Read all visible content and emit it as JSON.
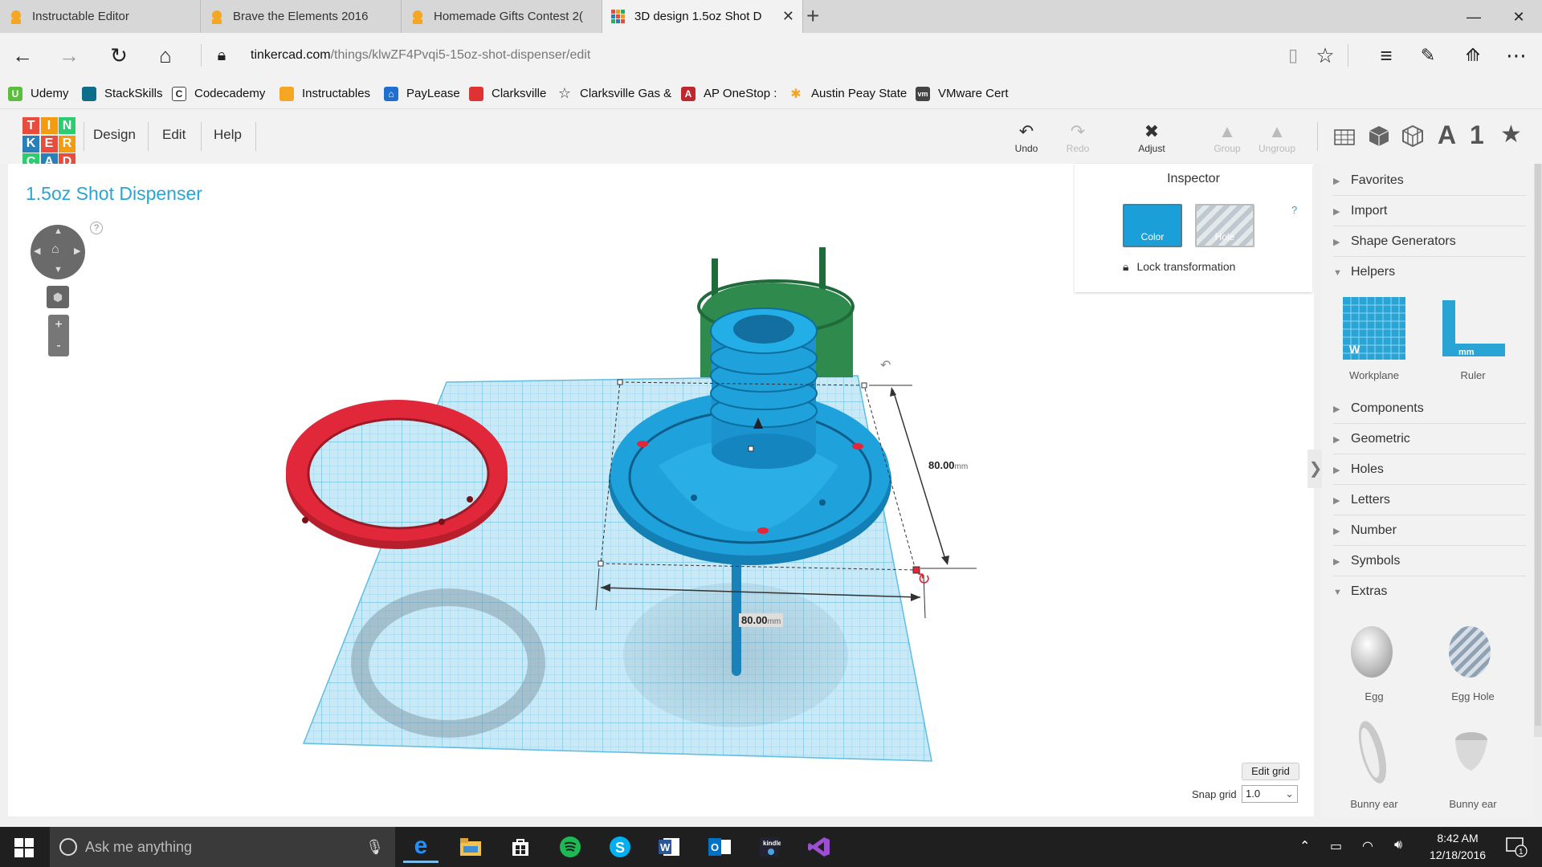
{
  "browser": {
    "tabs": [
      {
        "title": "Instructable Editor"
      },
      {
        "title": "Brave the Elements 2016"
      },
      {
        "title": "Homemade Gifts Contest 2("
      },
      {
        "title": "3D design 1.5oz Shot D",
        "active": true
      }
    ],
    "new_tab": "+",
    "window": {
      "minimize": "—",
      "maximize": "❐",
      "close": "✕"
    },
    "url_host": "tinkercad.com",
    "url_path": "/things/klwZF4Pvqi5-15oz-shot-dispenser/edit",
    "favorites": [
      {
        "label": "Udemy",
        "icon": "udemy-icon",
        "color": "#5bbf3d",
        "glyph": "U"
      },
      {
        "label": "StackSkills",
        "icon": "stackskills-icon",
        "color": "#0d6e8c",
        "glyph": ""
      },
      {
        "label": "Codecademy",
        "icon": "codecademy-icon",
        "color": "#ffffff",
        "glyph": "C"
      },
      {
        "label": "Instructables",
        "icon": "instructables-icon",
        "color": "#f5a623",
        "glyph": ""
      },
      {
        "label": "PayLease",
        "icon": "paylease-icon",
        "color": "#1e6fd1",
        "glyph": "⌂"
      },
      {
        "label": "Clarksville",
        "icon": "clarksville-icon",
        "color": "#d33",
        "glyph": ""
      },
      {
        "label": "Clarksville Gas &",
        "icon": "star-icon",
        "color": "#ffffff",
        "glyph": "☆"
      },
      {
        "label": "AP OneStop :",
        "icon": "ap-icon",
        "color": "#c0262d",
        "glyph": "A"
      },
      {
        "label": "Austin Peay State",
        "icon": "austin-peay-icon",
        "color": "#f5a623",
        "glyph": "✱"
      },
      {
        "label": "VMware Cert",
        "icon": "vmware-icon",
        "color": "#444444",
        "glyph": "vm"
      }
    ]
  },
  "app": {
    "logo_letters": [
      "T",
      "I",
      "N",
      "K",
      "E",
      "R",
      "C",
      "A",
      "D"
    ],
    "menu": [
      "Design",
      "Edit",
      "Help"
    ],
    "tools": [
      {
        "label": "Undo",
        "icon": "undo-icon",
        "enabled": true
      },
      {
        "label": "Redo",
        "icon": "redo-icon",
        "enabled": false
      },
      {
        "label": "Adjust",
        "icon": "adjust-icon",
        "enabled": true
      },
      {
        "label": "Group",
        "icon": "group-icon",
        "enabled": false
      },
      {
        "label": "Ungroup",
        "icon": "ungroup-icon",
        "enabled": false
      }
    ],
    "view_icons": [
      "workplane-view-icon",
      "box-view-icon",
      "wireframe-view-icon",
      "letters-view-icon",
      "number-view-icon",
      "favorites-star-icon"
    ],
    "view_glyphs": [
      "A",
      "1",
      "★"
    ],
    "design_title": "1.5oz Shot Dispenser",
    "help_mark": "?"
  },
  "inspector": {
    "title": "Inspector",
    "color_label": "Color",
    "hole_label": "Hole",
    "help": "?",
    "lock_label": "Lock transformation",
    "color_swatch": "#1a9fd9"
  },
  "dimensions": {
    "width_value": "80.00",
    "depth_value": "80.00",
    "unit": "mm"
  },
  "panel": {
    "categories": [
      {
        "label": "Favorites",
        "expanded": false
      },
      {
        "label": "Import",
        "expanded": false
      },
      {
        "label": "Shape Generators",
        "expanded": false
      },
      {
        "label": "Helpers",
        "expanded": true
      },
      {
        "label": "Components",
        "expanded": false
      },
      {
        "label": "Geometric",
        "expanded": false
      },
      {
        "label": "Holes",
        "expanded": false
      },
      {
        "label": "Letters",
        "expanded": false
      },
      {
        "label": "Number",
        "expanded": false
      },
      {
        "label": "Symbols",
        "expanded": false
      },
      {
        "label": "Extras",
        "expanded": true
      }
    ],
    "helpers": [
      {
        "label": "Workplane"
      },
      {
        "label": "Ruler"
      }
    ],
    "extras": [
      {
        "label": "Egg"
      },
      {
        "label": "Egg Hole"
      },
      {
        "label": "Bunny ear"
      },
      {
        "label": "Bunny ear"
      }
    ],
    "collapse": "❯"
  },
  "grid": {
    "edit_label": "Edit grid",
    "snap_label": "Snap grid",
    "snap_value": "1.0"
  },
  "taskbar": {
    "search_placeholder": "Ask me anything",
    "time": "8:42 AM",
    "date": "12/18/2016",
    "notifications": "1",
    "apps": [
      {
        "name": "edge-icon",
        "glyph": "e",
        "color": "#1e90ff"
      },
      {
        "name": "file-explorer-icon",
        "glyph": "▬",
        "color": "#f2c14e"
      },
      {
        "name": "store-icon",
        "glyph": "▦",
        "color": "#ffffff"
      },
      {
        "name": "spotify-icon",
        "glyph": "●",
        "color": "#1db954"
      },
      {
        "name": "skype-icon",
        "glyph": "S",
        "color": "#00aff0"
      },
      {
        "name": "word-icon",
        "glyph": "W",
        "color": "#2b579a"
      },
      {
        "name": "outlook-icon",
        "glyph": "O",
        "color": "#0072c6"
      },
      {
        "name": "kindle-icon",
        "glyph": "k",
        "color": "#ffffff"
      },
      {
        "name": "visual-studio-icon",
        "glyph": "∞",
        "color": "#9b4fd1"
      }
    ]
  }
}
